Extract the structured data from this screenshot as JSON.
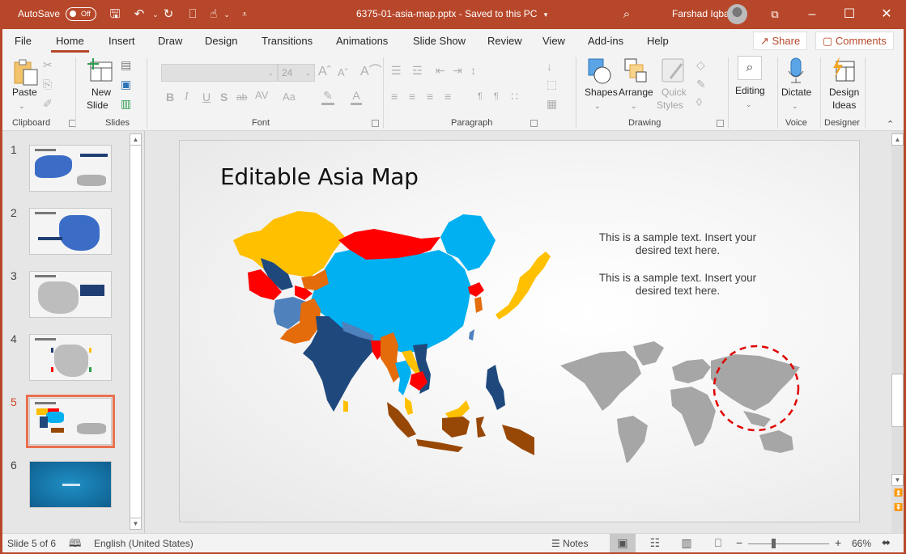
{
  "titlebar": {
    "autosave_label": "AutoSave",
    "autosave_state": "Off",
    "document_title": "6375-01-asia-map.pptx  -  Saved to this PC",
    "user_name": "Farshad Iqbal",
    "quick_access": [
      "save-icon",
      "undo-icon",
      "redo-icon",
      "present-from-start-icon",
      "touch-mode-icon",
      "customize-qat-icon"
    ]
  },
  "tabs": [
    {
      "label": "File"
    },
    {
      "label": "Home",
      "active": true
    },
    {
      "label": "Insert"
    },
    {
      "label": "Draw"
    },
    {
      "label": "Design"
    },
    {
      "label": "Transitions"
    },
    {
      "label": "Animations"
    },
    {
      "label": "Slide Show"
    },
    {
      "label": "Review"
    },
    {
      "label": "View"
    },
    {
      "label": "Add-ins"
    },
    {
      "label": "Help"
    }
  ],
  "share_label": "Share",
  "comments_label": "Comments",
  "ribbon": {
    "clipboard": {
      "label": "Clipboard",
      "paste": "Paste"
    },
    "slides": {
      "label": "Slides",
      "new_slide_line1": "New",
      "new_slide_line2": "Slide"
    },
    "font": {
      "label": "Font",
      "font_name": "",
      "font_size": "24",
      "bold": "B",
      "italic": "I",
      "underline": "U",
      "shadow": "S",
      "strike": "ab",
      "spacing": "AV",
      "case": "Aa"
    },
    "paragraph": {
      "label": "Paragraph"
    },
    "drawing": {
      "label": "Drawing",
      "shapes": "Shapes",
      "arrange": "Arrange",
      "quick_styles_line1": "Quick",
      "quick_styles_line2": "Styles"
    },
    "editing": {
      "label": "Editing"
    },
    "voice": {
      "label": "Voice",
      "dictate": "Dictate"
    },
    "designer": {
      "label": "Designer",
      "design_ideas_line1": "Design",
      "design_ideas_line2": "Ideas"
    }
  },
  "thumbnails": [
    {
      "number": "1"
    },
    {
      "number": "2"
    },
    {
      "number": "3"
    },
    {
      "number": "4"
    },
    {
      "number": "5",
      "active": true
    },
    {
      "number": "6"
    }
  ],
  "slide": {
    "title": "Editable Asia Map",
    "text_1_line1": "This is a sample text. Insert your",
    "text_1_line2": "desired text here.",
    "text_2_line1": "This is a sample text. Insert your",
    "text_2_line2": "desired text here.",
    "colors": {
      "yellow": "#ffc000",
      "red": "#ff0000",
      "light_blue": "#00b0f0",
      "navy": "#1f497d",
      "orange": "#e46c0a",
      "steel_blue": "#4f81bd",
      "brown": "#984806",
      "world_grey": "#a6a6a6",
      "highlight_circle": "#e00000"
    }
  },
  "statusbar": {
    "slide_indicator": "Slide 5 of 6",
    "language": "English (United States)",
    "notes_label": "Notes",
    "zoom_percent": "66%",
    "zoom_value": 66
  }
}
